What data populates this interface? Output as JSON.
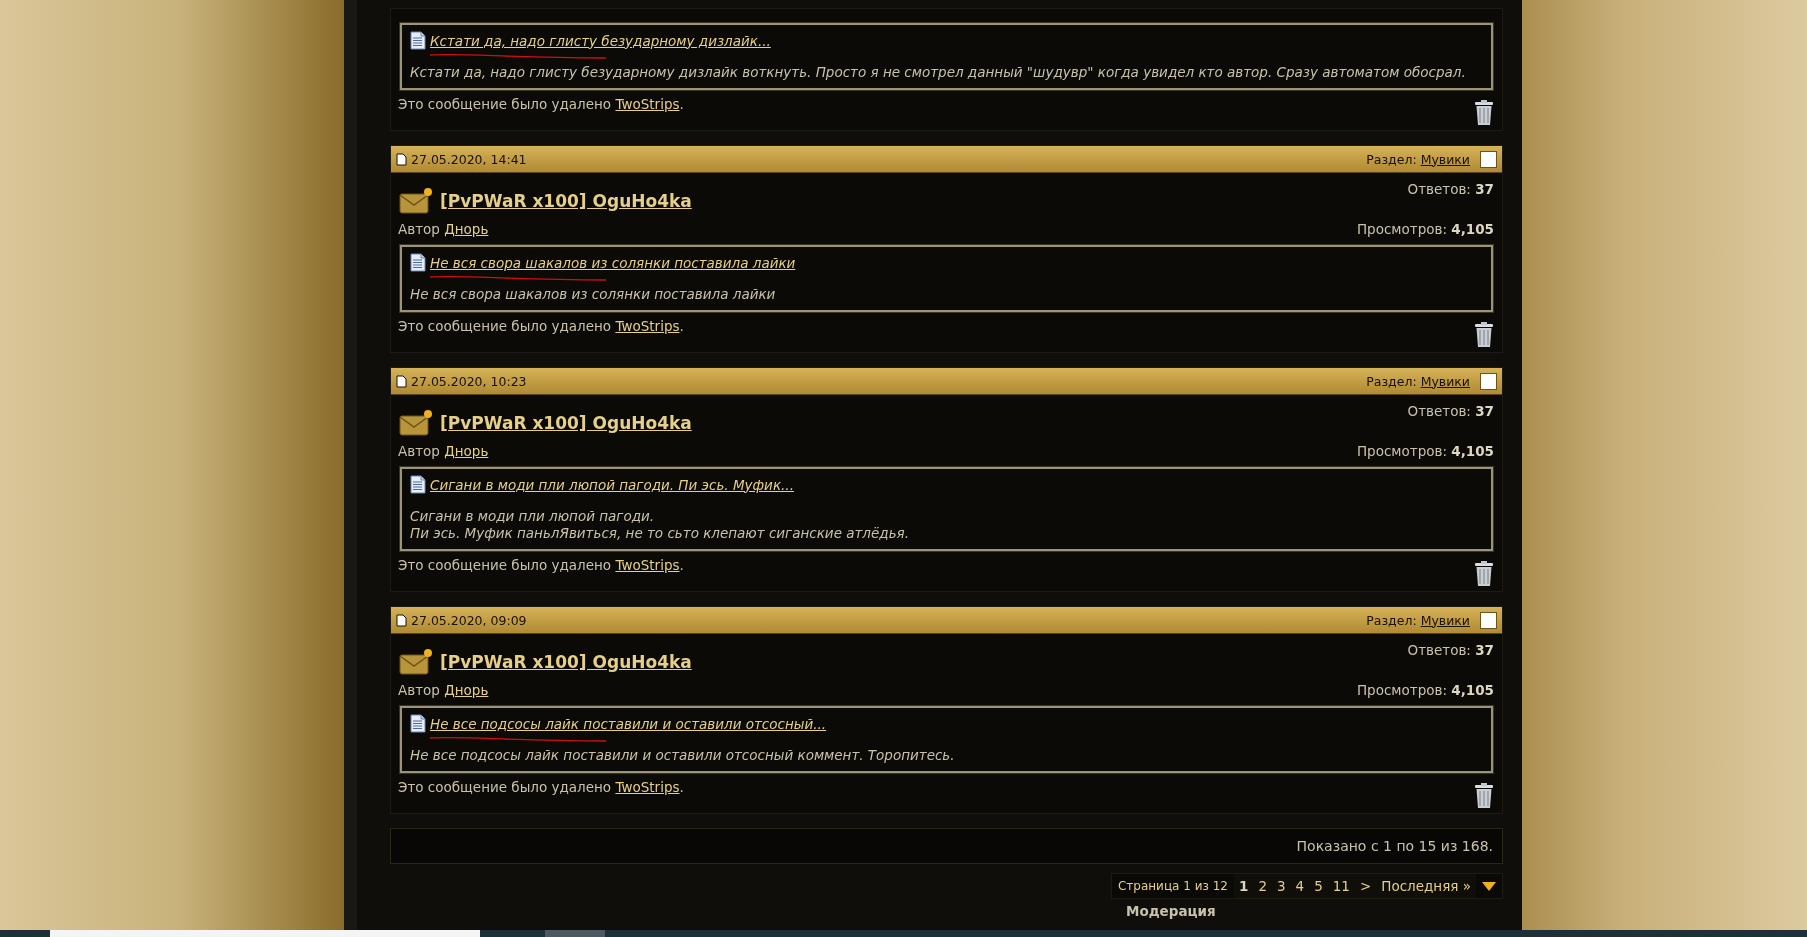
{
  "posts": [
    {
      "snippet": {
        "title": "Кстати да, надо глисту безударному дизлайк...",
        "lines": [
          "Кстати да, надо глисту безударному дизлайк воткнуть. Просто я не смотрел данный \"шудувр\" когда увидел кто автор. Сразу автоматом обосрал."
        ],
        "scribble": true
      },
      "deleted_text": "Это сообщение было удалено",
      "deleted_by": "TwoStrips",
      "deleted_end": "."
    },
    {
      "date": "27.05.2020, 14:41",
      "section_label": "Раздел:",
      "section": "Мувики",
      "checked": false,
      "title": "[PvPWaR x100] OguHo4ka",
      "replies_label": "Ответов:",
      "replies": "37",
      "author_label": "Автор",
      "author": "Днорь",
      "views_label": "Просмотров:",
      "views": "4,105",
      "snippet": {
        "title": "Не вся свора шакалов из солянки поставила лайки",
        "lines": [
          "Не вся свора шакалов из солянки поставила лайки"
        ],
        "scribble": true
      },
      "deleted_text": "Это сообщение было удалено",
      "deleted_by": "TwoStrips",
      "deleted_end": "."
    },
    {
      "date": "27.05.2020, 10:23",
      "section_label": "Раздел:",
      "section": "Мувики",
      "checked": false,
      "title": "[PvPWaR x100] OguHo4ka",
      "replies_label": "Ответов:",
      "replies": "37",
      "author_label": "Автор",
      "author": "Днорь",
      "views_label": "Просмотров:",
      "views": "4,105",
      "snippet": {
        "title": "Сигани в моди пли люпой пагоди. Пи эсь. Муфик...",
        "lines": [
          "Сигани в моди пли люпой пагоди.",
          "Пи эсь. Муфик паньлЯвиться, не то сьто клепают сиганские атлёдья."
        ],
        "scribble": false
      },
      "deleted_text": "Это сообщение было удалено",
      "deleted_by": "TwoStrips",
      "deleted_end": "."
    },
    {
      "date": "27.05.2020, 09:09",
      "section_label": "Раздел:",
      "section": "Мувики",
      "checked": false,
      "title": "[PvPWaR x100] OguHo4ka",
      "replies_label": "Ответов:",
      "replies": "37",
      "author_label": "Автор",
      "author": "Днорь",
      "views_label": "Просмотров:",
      "views": "4,105",
      "snippet": {
        "title": "Не все подсосы лайк поставили и оставили отсосный...",
        "lines": [
          "Не все подсосы лайк поставили и оставили отсосный коммент. Торопитесь."
        ],
        "scribble": true
      },
      "deleted_text": "Это сообщение было удалено",
      "deleted_by": "TwoStrips",
      "deleted_end": "."
    }
  ],
  "summary": "Показано с 1 по 15 из 168.",
  "pager": {
    "label": "Страница 1 из 12",
    "pages": [
      {
        "label": "1",
        "selected": true
      },
      {
        "label": "2",
        "selected": false
      },
      {
        "label": "3",
        "selected": false
      },
      {
        "label": "4",
        "selected": false
      },
      {
        "label": "5",
        "selected": false
      },
      {
        "label": "11",
        "selected": false
      }
    ],
    "next": ">",
    "last": "Последняя »"
  },
  "moderation": "Модерация"
}
